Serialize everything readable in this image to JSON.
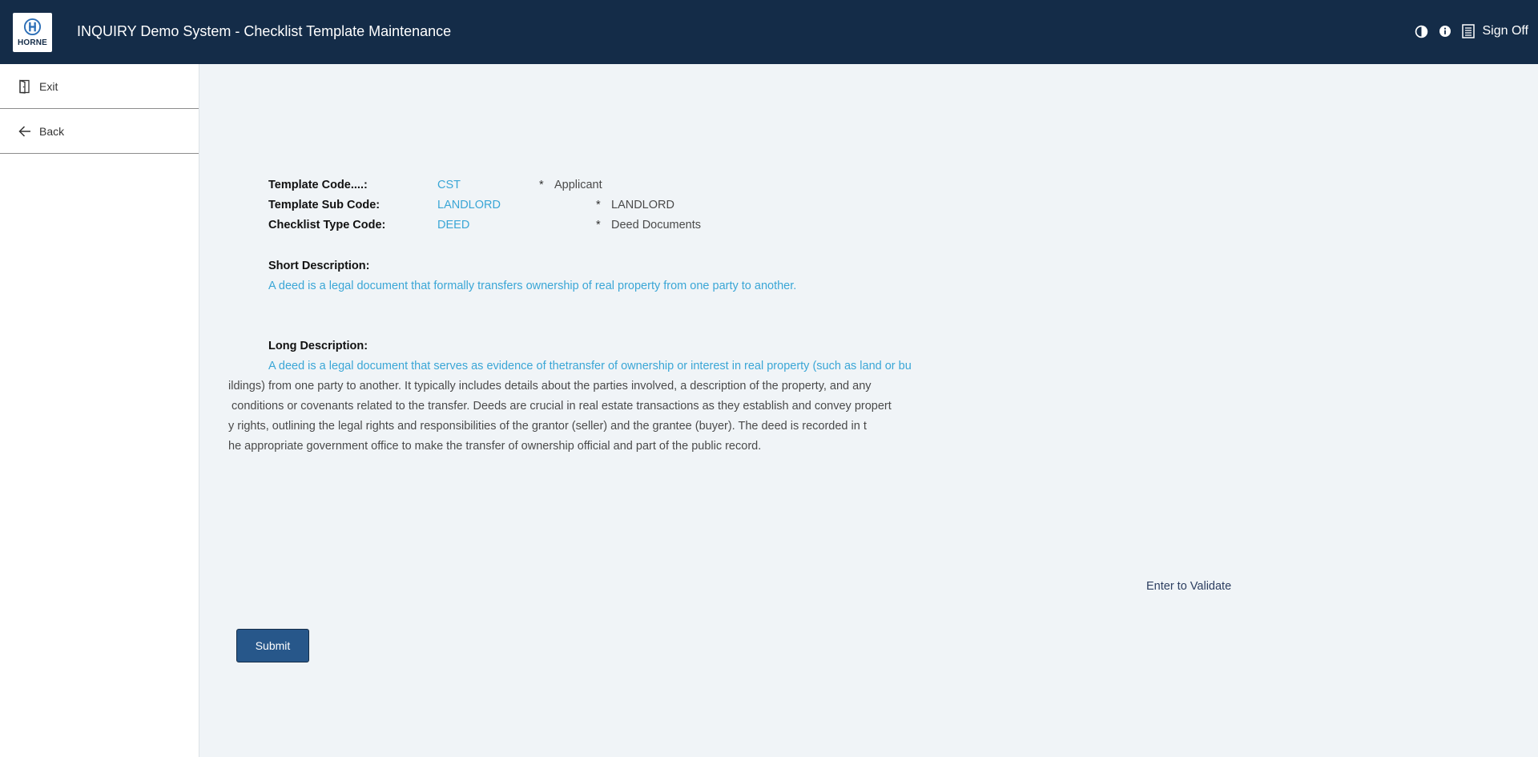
{
  "header": {
    "logo_text": "HORNE",
    "title": "INQUIRY Demo System - Checklist Template Maintenance",
    "sign_off": "Sign Off"
  },
  "sidebar": {
    "items": [
      {
        "label": "Exit",
        "icon": "door-exit-icon"
      },
      {
        "label": "Back",
        "icon": "arrow-left-icon"
      }
    ]
  },
  "form": {
    "template_code": {
      "label": "Template Code....:",
      "value": "CST",
      "star": "*",
      "description": "Applicant"
    },
    "template_sub_code": {
      "label": "Template Sub Code:",
      "value": "LANDLORD",
      "star": "*",
      "description": "LANDLORD"
    },
    "checklist_type_code": {
      "label": "Checklist Type Code:",
      "value": "DEED",
      "star": "*",
      "description": "Deed Documents"
    },
    "short_description": {
      "label": "Short Description:",
      "value": "A deed is a legal document that formally transfers ownership of real property from one party to another."
    },
    "long_description": {
      "label": "Long Description:",
      "lines": [
        "A deed is a legal document that serves as evidence of thetransfer of ownership or interest in real property (such as land or bu",
        "ildings) from one party to another. It typically includes details about the parties involved, a description of the property, and any",
        " conditions or covenants related to the transfer. Deeds are crucial in real estate transactions as they establish and convey propert",
        "y rights, outlining the legal rights and responsibilities of the grantor (seller) and the grantee (buyer). The deed is recorded in t",
        "he appropriate government office to make the transfer of ownership official and part of the public record."
      ]
    }
  },
  "hint": "Enter to Validate",
  "submit_label": "Submit",
  "colors": {
    "header_bg": "#142c48",
    "value_text": "#3aa6d6",
    "button_bg": "#27578a",
    "content_bg": "#f0f4f7"
  }
}
